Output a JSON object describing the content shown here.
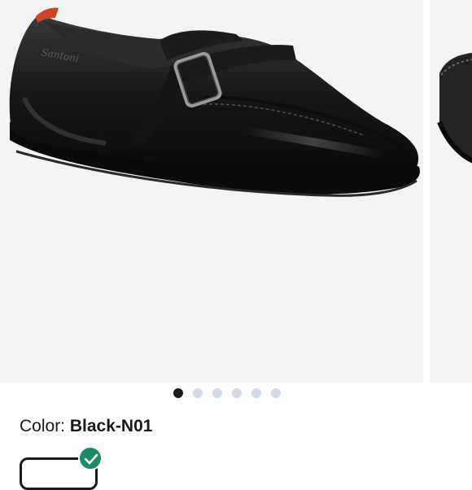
{
  "gallery": {
    "images": [
      {
        "icon": "black-leather-driving-loafer-image",
        "alt": "Black leather driving loafer with buckle strap"
      },
      {
        "icon": "loafer-image-next"
      }
    ],
    "slide_count": 6,
    "active_index": 0
  },
  "product": {
    "color_label": "Color:",
    "color_value": "Black-N01"
  },
  "swatch": {
    "selected": true,
    "check_color": "#1f8a6a"
  },
  "colors": {
    "dot_active": "#1b1b1b",
    "dot_inactive": "#d4dbe6",
    "image_background": "#f3f3f3"
  }
}
